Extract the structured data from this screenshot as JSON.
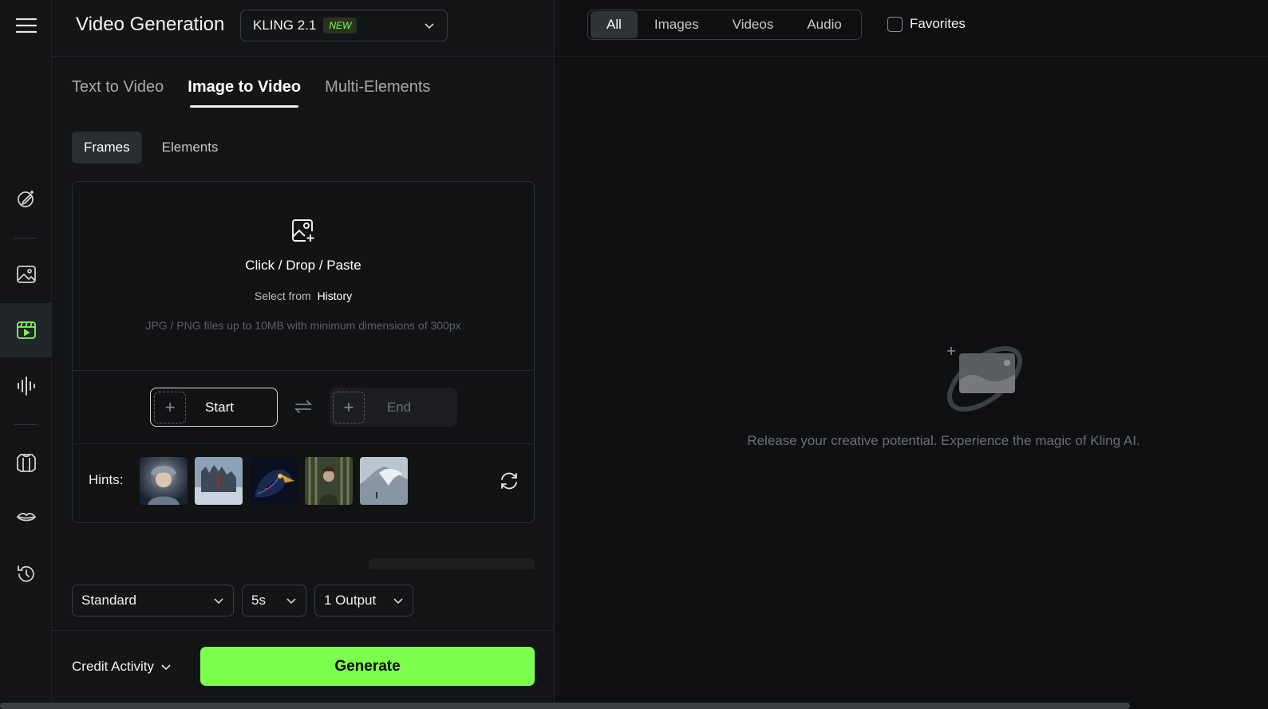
{
  "rail": {
    "icons": [
      "menu-icon",
      "edit-sparkle-icon",
      "image-icon",
      "video-icon",
      "audio-wave-icon",
      "shirt-icon",
      "lips-icon",
      "history-icon"
    ]
  },
  "header": {
    "title": "Video Generation",
    "model": "KLING 2.1",
    "model_badge": "NEW"
  },
  "tabs": [
    "Text to Video",
    "Image to Video",
    "Multi-Elements"
  ],
  "active_tab": "Image to Video",
  "subtabs": [
    "Frames",
    "Elements"
  ],
  "upload": {
    "title": "Click / Drop / Paste",
    "select_prefix": "Select from",
    "select_link": "History",
    "note": "JPG / PNG files up to 10MB with minimum dimensions of 300px",
    "start_label": "Start",
    "end_label": "End",
    "hints_label": "Hints:"
  },
  "options": {
    "mode": "Standard",
    "duration": "5s",
    "outputs": "1 Output"
  },
  "footer": {
    "credit_label": "Credit Activity",
    "generate_label": "Generate"
  },
  "right": {
    "filters": [
      "All",
      "Images",
      "Videos",
      "Audio"
    ],
    "active_filter": "All",
    "favorites_label": "Favorites",
    "favorites_checked": false,
    "empty_text": "Release your creative potential. Experience the magic of Kling AI."
  },
  "colors": {
    "accent": "#7dff4e",
    "panel": "#141517",
    "background": "#0f1011"
  }
}
